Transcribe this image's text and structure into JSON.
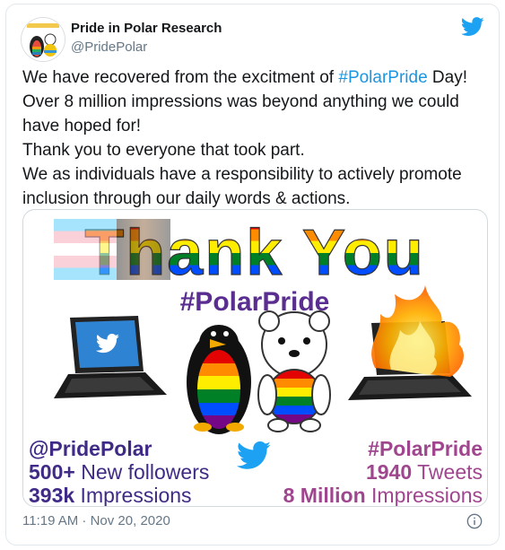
{
  "account": {
    "name": "Pride in Polar Research",
    "handle": "@PridePolar",
    "avatar_icon": "penguin-polar-bear-icon"
  },
  "tweet": {
    "line1_before": "We have recovered from the excitment of ",
    "line1_hashtag": "#PolarPride",
    "line1_after": " Day!",
    "line2": "Over 8 million impressions was beyond anything we could have hoped for!",
    "line3": "Thank you to everyone that took part.",
    "line4": "We as individuals have a responsibility to actively promote inclusion through our daily words & actions."
  },
  "image": {
    "title": "Thank You",
    "hashtag_center": "#PolarPride",
    "left": {
      "handle": "@PridePolar",
      "followers_num": "500+",
      "followers_label": " New followers",
      "impressions_num": "393k",
      "impressions_label": " Impressions"
    },
    "right": {
      "hashtag": "#PolarPride",
      "tweets_num": "1940",
      "tweets_label": " Tweets",
      "impressions_num": "8 Million",
      "impressions_label": " Impressions"
    }
  },
  "footer": {
    "timestamp": "11:19 AM · Nov 20, 2020"
  },
  "colors": {
    "twitter_blue": "#1da1f2",
    "link_blue": "#1b95e0",
    "purple": "#4b2a8c",
    "magenta": "#a0468f"
  }
}
